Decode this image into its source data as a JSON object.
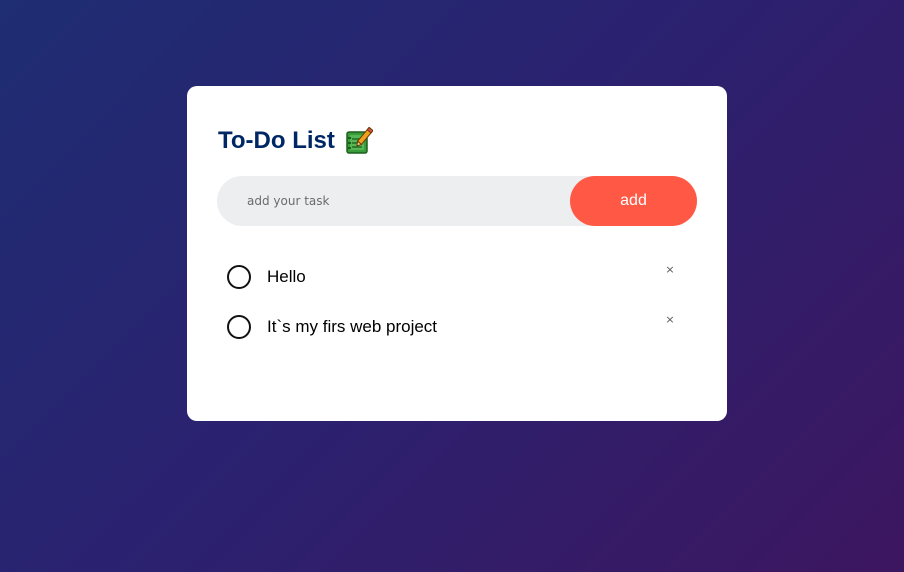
{
  "app": {
    "title": "To-Do List",
    "title_icon": "notebook-with-pencil-icon"
  },
  "input": {
    "placeholder": "add your task",
    "value": ""
  },
  "add_button": {
    "label": "add"
  },
  "tasks": [
    {
      "text": "Hello",
      "checked": false,
      "delete_label": "×"
    },
    {
      "text": "It`s my firs web project",
      "checked": false,
      "delete_label": "×"
    }
  ],
  "colors": {
    "accent": "#ff5945",
    "title": "#002765",
    "background_start": "#1f2d72",
    "background_end": "#3d1660"
  }
}
